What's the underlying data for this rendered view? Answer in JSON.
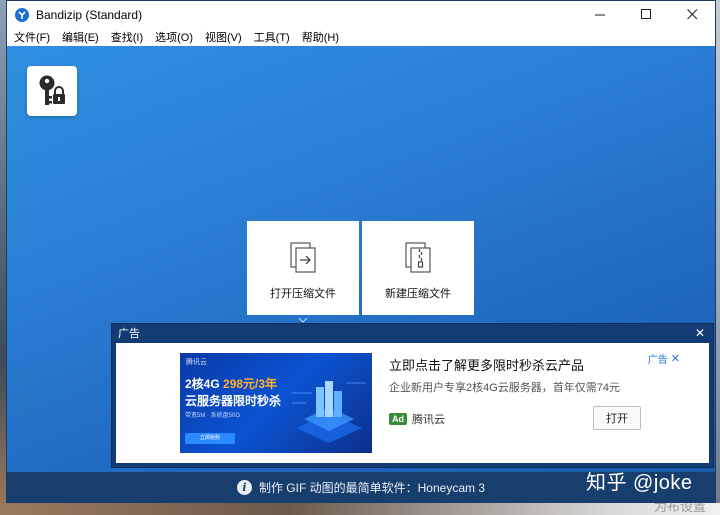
{
  "window": {
    "title": "Bandizip (Standard)",
    "controls": {
      "minimize": "—",
      "maximize": "☐",
      "close": "✕"
    }
  },
  "menu": [
    {
      "label": "文件(F)"
    },
    {
      "label": "编辑(E)"
    },
    {
      "label": "查找(I)"
    },
    {
      "label": "选项(O)"
    },
    {
      "label": "视图(V)"
    },
    {
      "label": "工具(T)"
    },
    {
      "label": "帮助(H)"
    }
  ],
  "main": {
    "open_archive_label": "打开压缩文件",
    "new_archive_label": "新建压缩文件"
  },
  "ad": {
    "header_title": "广告",
    "close": "✕",
    "banner": {
      "brand": "腾讯云",
      "line1_prefix": "2核4G ",
      "line1_price": "298元/3年",
      "line2": "云服务器限时秒杀",
      "line3": "带宽5M · 系统盘50G",
      "button": "立即抢购"
    },
    "headline": "立即点击了解更多限时秒杀云产品",
    "description": "企业新用户专享2核4G云服务器，首年仅需74元",
    "badge": "Ad",
    "advertiser": "腾讯云",
    "ad_label": "广告",
    "ad_label_x": "✕",
    "open_button": "打开"
  },
  "status": {
    "info_glyph": "i",
    "text": "制作 GIF 动图的最简单软件：Honeycam 3"
  },
  "overlay": {
    "watermark": "知乎 @joke",
    "desktop_text": "为布设置"
  },
  "colors": {
    "main_gradient_start": "#2f8fe0",
    "main_gradient_end": "#1a5aad",
    "ad_panel": "#123c73",
    "status_bar": "#183e6e",
    "ad_badge": "#3a8a3c",
    "price": "#ffb02e"
  }
}
